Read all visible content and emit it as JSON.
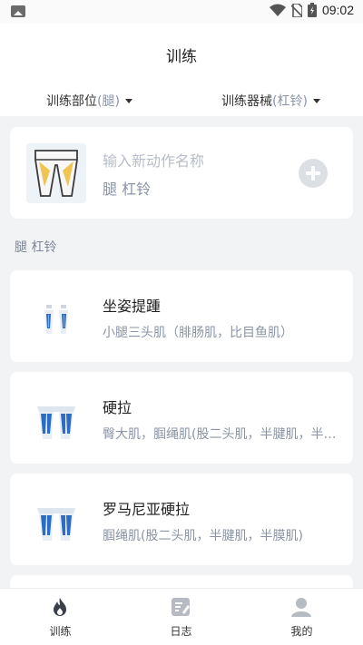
{
  "status_bar": {
    "time": "09:02"
  },
  "header": {
    "title": "训练"
  },
  "filters": {
    "part_label": "训练部位",
    "part_value": "(腿)",
    "equip_label": "训练器械",
    "equip_value": "(杠铃)"
  },
  "new_action": {
    "placeholder": "输入新动作名称",
    "tags": "腿 杠铃"
  },
  "section": {
    "label": "腿 杠铃"
  },
  "exercises": [
    {
      "name": "坐姿提踵",
      "muscles": "小腿三头肌（腓肠肌，比目鱼肌）"
    },
    {
      "name": "硬拉",
      "muscles": "臀大肌，腘绳肌(股二头肌，半腱肌，半膜肌)"
    },
    {
      "name": "罗马尼亚硬拉",
      "muscles": "腘绳肌(股二头肌，半腱肌，半膜肌)"
    }
  ],
  "tabs": [
    {
      "label": "训练"
    },
    {
      "label": "日志"
    },
    {
      "label": "我的"
    }
  ],
  "colors": {
    "accent": "#2b6cc4",
    "muted": "#8a94a6",
    "active_icon": "#3a3f4a",
    "inactive_icon": "#b5bac3"
  }
}
